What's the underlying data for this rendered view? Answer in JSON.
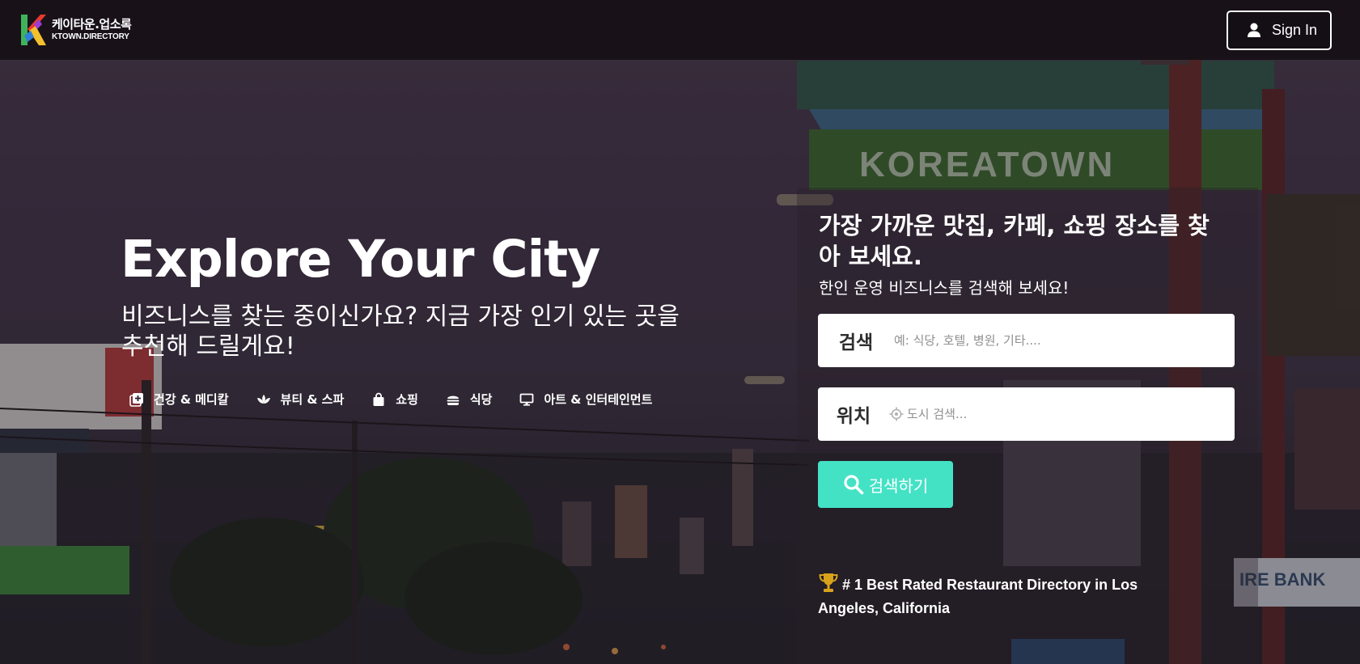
{
  "brand": {
    "name_ko": "케이타운.업소록",
    "name_en": "KTOWN.DIRECTORY"
  },
  "header": {
    "signin_label": "Sign In"
  },
  "hero": {
    "title": "Explore Your City",
    "subtitle": "비즈니스를 찾는 중이신가요? 지금 가장 인기 있는 곳을 추천해 드릴게요!",
    "categories": [
      {
        "label": "건강 & 메디칼",
        "icon": "medical-plus-icon"
      },
      {
        "label": "뷰티 & 스파",
        "icon": "lotus-icon"
      },
      {
        "label": "쇼핑",
        "icon": "shopping-bag-icon"
      },
      {
        "label": "식당",
        "icon": "burger-icon"
      },
      {
        "label": "아트 & 인터테인먼트",
        "icon": "monitor-icon"
      }
    ]
  },
  "background": {
    "sign_text": "KOREATOWN",
    "bank_text": "IRE BANK"
  },
  "search_panel": {
    "heading": "가장 가까운 맛집, 카페, 쇼핑 장소를 찾아 보세요.",
    "subheading": "한인 운영 비즈니스를 검색해 보세요!",
    "search_label": "검색",
    "search_placeholder": "예: 식당, 호텔, 병원, 기타....",
    "location_label": "위치",
    "location_placeholder": "도시 검색...",
    "submit_label": "검색하기"
  },
  "award": {
    "text": "# 1 Best Rated Restaurant Directory in Los Angeles, California"
  },
  "colors": {
    "accent": "#43e2c5",
    "header_bg": "#181218",
    "trophy": "#d9a21b"
  }
}
